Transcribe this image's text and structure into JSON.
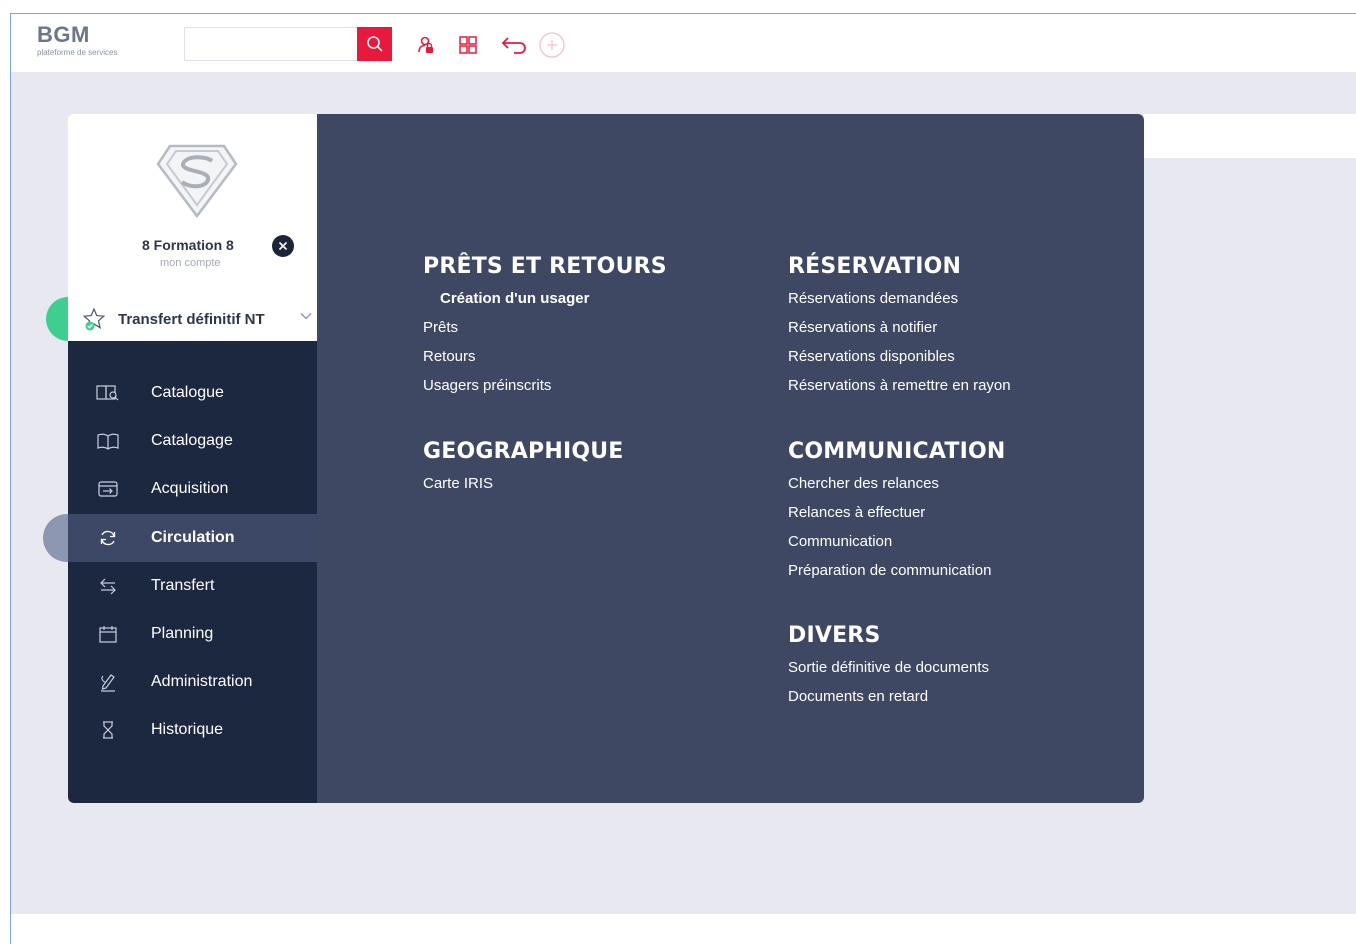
{
  "brand": {
    "name": "BGM",
    "subtitle": "plateforme de services"
  },
  "search": {
    "value": "",
    "placeholder": ""
  },
  "toolbar": {
    "icons": [
      "search-icon",
      "user-lock-icon",
      "grid-icon",
      "undo-arrow-icon",
      "add-circle-icon"
    ]
  },
  "colors": {
    "accent": "#e8193c",
    "nav_bg": "#1c2740",
    "menu_bg": "#3e4863",
    "active_item": "#3d4866",
    "green": "#3ecf8e"
  },
  "profile": {
    "name": "8 Formation 8",
    "subtitle": "mon compte",
    "transfer_label": "Transfert définitif NT"
  },
  "nav": {
    "items": [
      {
        "label": "Catalogue",
        "icon": "catalog-book-search-icon"
      },
      {
        "label": "Catalogage",
        "icon": "open-book-icon"
      },
      {
        "label": "Acquisition",
        "icon": "inbox-arrow-icon"
      },
      {
        "label": "Circulation",
        "icon": "refresh-cycle-icon",
        "active": true
      },
      {
        "label": "Transfert",
        "icon": "swap-arrows-icon"
      },
      {
        "label": "Planning",
        "icon": "calendar-icon"
      },
      {
        "label": "Administration",
        "icon": "pen-admin-icon"
      },
      {
        "label": "Historique",
        "icon": "hourglass-icon"
      }
    ]
  },
  "menu": {
    "prets": {
      "title": "PRÊTS ET RETOURS",
      "links": [
        "Création d'un usager",
        "Prêts",
        "Retours",
        "Usagers préinscrits"
      ]
    },
    "geo": {
      "title": "GEOGRAPHIQUE",
      "links": [
        "Carte IRIS"
      ]
    },
    "reservation": {
      "title": "RÉSERVATION",
      "links": [
        "Réservations demandées",
        "Réservations à notifier",
        "Réservations disponibles",
        "Réservations à remettre en rayon"
      ]
    },
    "communication": {
      "title": "COMMUNICATION",
      "links": [
        "Chercher des relances",
        "Relances à effectuer",
        "Communication",
        "Préparation de communication"
      ]
    },
    "divers": {
      "title": "DIVERS",
      "links": [
        "Sortie définitive de documents",
        "Documents en retard"
      ]
    }
  }
}
